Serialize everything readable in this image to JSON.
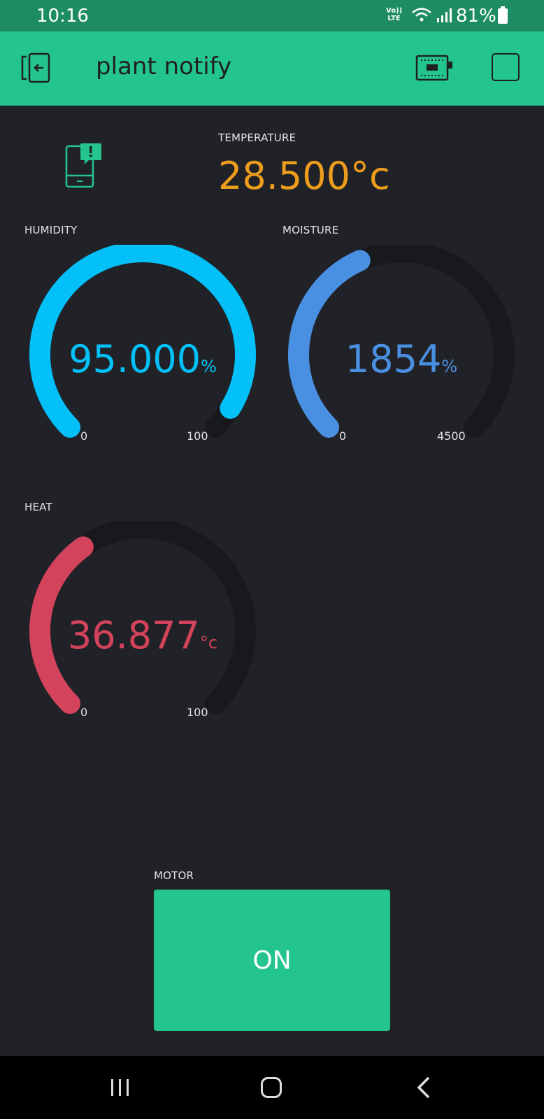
{
  "status_bar": {
    "time": "10:16",
    "network_top": "Vo))",
    "network_bottom": "LTE",
    "battery": "81%"
  },
  "app_bar": {
    "title": "plant notify"
  },
  "notification": {
    "icon": "phone-notification-icon"
  },
  "temperature": {
    "label": "TEMPERATURE",
    "value": "28.500°c",
    "color": "#ed9d1c"
  },
  "humidity": {
    "label": "HUMIDITY",
    "value": "95.000",
    "unit": "%",
    "min": "0",
    "max": "100",
    "level": 0.95,
    "color": "#04c0f8"
  },
  "moisture": {
    "label": "MOISTURE",
    "value": "1854",
    "unit": "%",
    "min": "0",
    "max": "4500",
    "level": 0.412,
    "color": "#4a90e2"
  },
  "heat": {
    "label": "HEAT",
    "value": "36.877",
    "unit": "°c",
    "min": "0",
    "max": "100",
    "level": 0.369,
    "color": "#d3435c"
  },
  "motor": {
    "label": "MOTOR",
    "button_label": "ON",
    "color": "#23c48e"
  },
  "nav": {
    "icons": [
      "recent-apps-icon",
      "home-icon",
      "back-icon"
    ]
  }
}
